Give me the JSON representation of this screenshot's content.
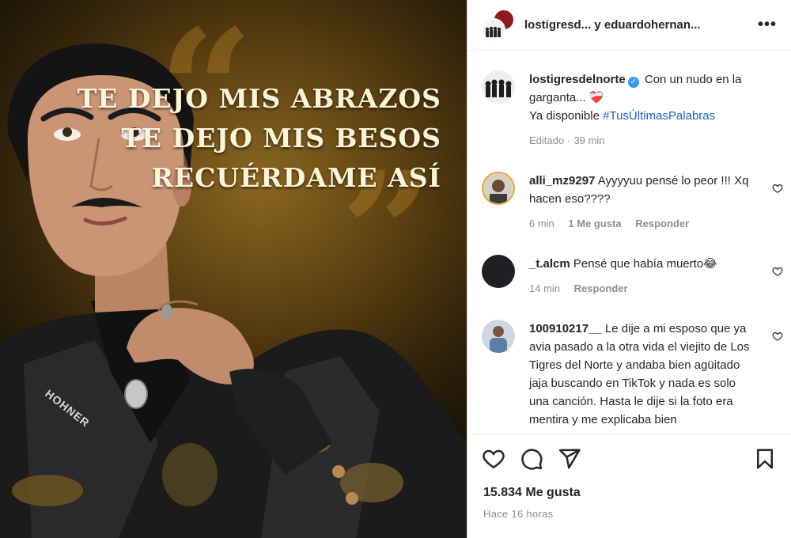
{
  "post_image": {
    "lyrics": [
      "TE DEJO MIS ABRAZOS",
      "TE DEJO MIS BESOS",
      "RECUÉRDAME ASÍ"
    ],
    "jacket_brand": "HOHNER"
  },
  "header": {
    "title": "lostigresd... y eduardohernan..."
  },
  "caption": {
    "username": "lostigresdelnorte",
    "text_line1": "Con un nudo en la garganta... ❤️‍🩹",
    "text_line2": "Ya disponible",
    "hashtag": "#TusÚltimasPalabras",
    "edited": "Editado",
    "time": "39 min"
  },
  "comments": [
    {
      "username": "alli_mz9297",
      "text": "Ayyyyuu pensé lo peor !!! Xq hacen eso????",
      "time": "6 min",
      "likes": "1 Me gusta",
      "reply": "Responder"
    },
    {
      "username": "_t.alcm",
      "text": "Pensé que había muerto😂",
      "time": "14 min",
      "reply": "Responder"
    },
    {
      "username": "100910217__",
      "text": "Le dije a mi esposo que ya avia pasado a la otra vida el viejito de Los Tigres del Norte y andaba bien agüitado jaja buscando en TikTok y nada es solo una canción. Hasta le dije si la foto era mentira y me explicaba bien"
    }
  ],
  "footer": {
    "likes": "15.834 Me gusta",
    "time_ago": "Hace 16 horas"
  },
  "colors": {
    "link": "#1d5fbf",
    "verified": "#3897f0",
    "muted": "#8e8e8e"
  }
}
